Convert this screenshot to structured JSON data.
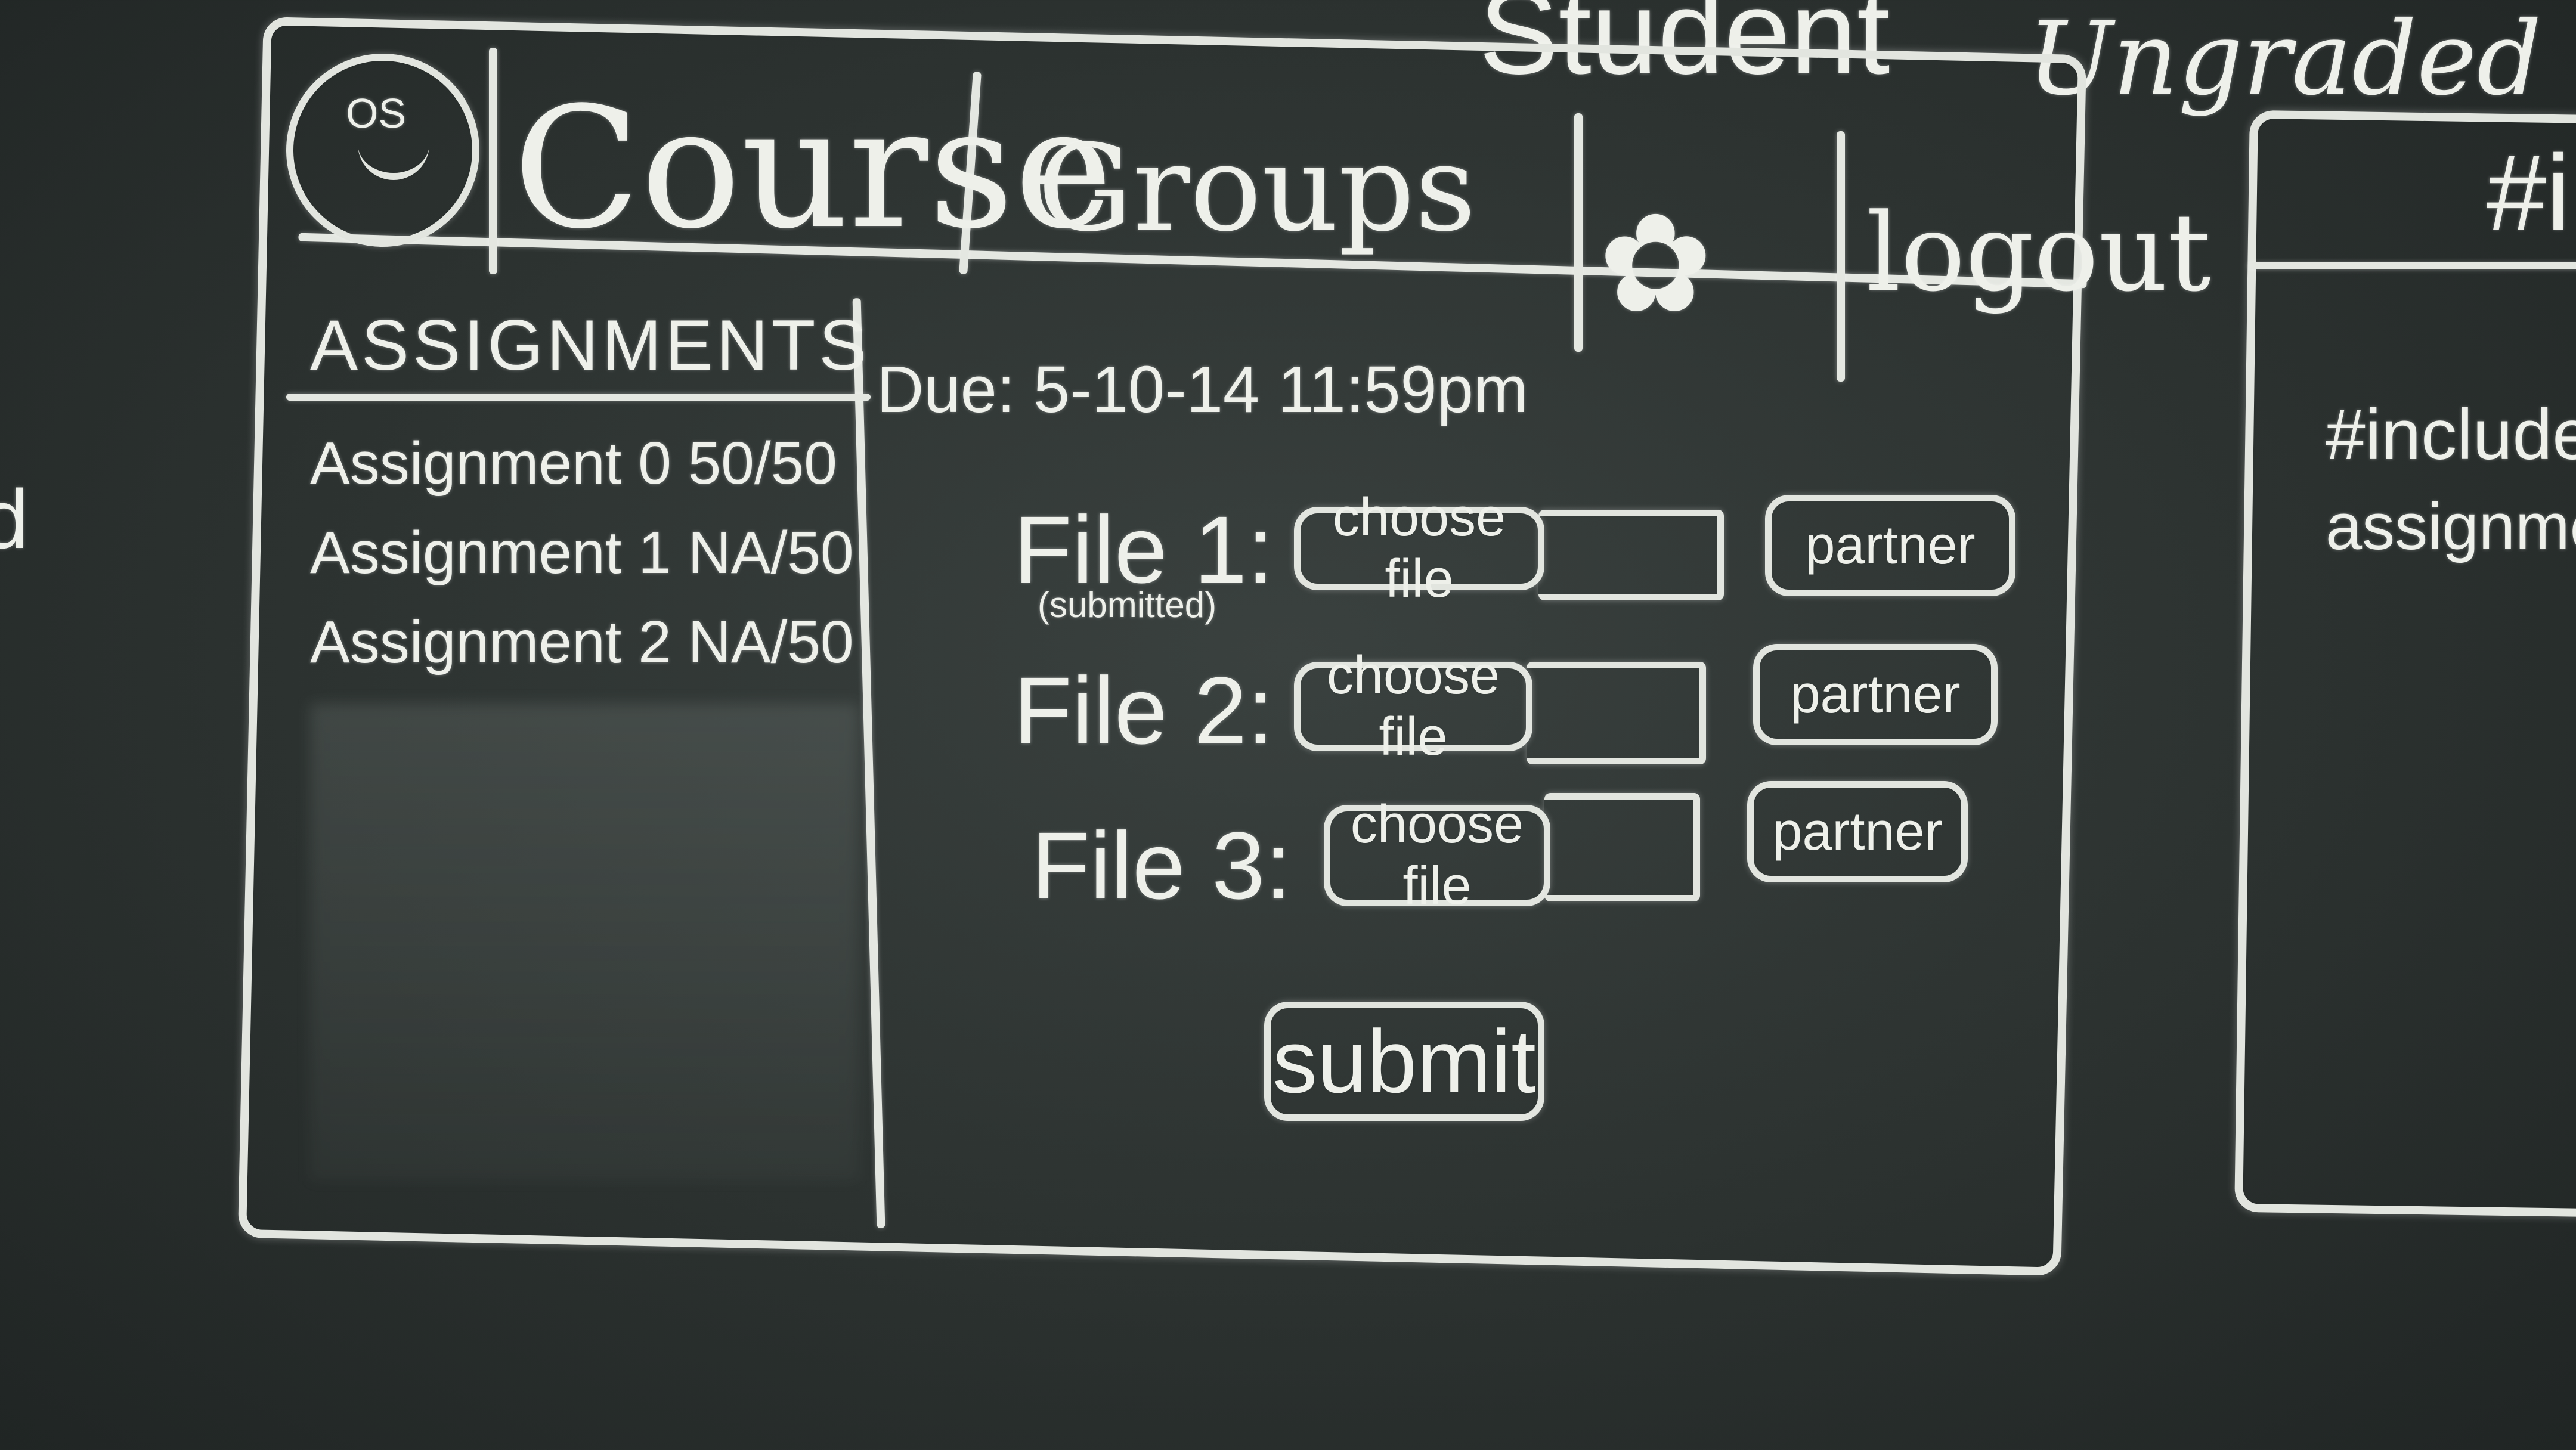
{
  "board": {
    "top_scrawl": "Student",
    "top_right_label": "Ungraded",
    "left_fragment": "d"
  },
  "header": {
    "logo_text": "OS",
    "nav_items": [
      "Course",
      "Groups"
    ],
    "settings_icon": "gear-icon",
    "logout_label": "logout"
  },
  "sidebar": {
    "title": "ASSIGNMENTS",
    "items": [
      {
        "label": "Assignment 0",
        "score": "50/50"
      },
      {
        "label": "Assignment 1",
        "score": "NA/50"
      },
      {
        "label": "Assignment 2",
        "score": "NA/50"
      }
    ]
  },
  "main": {
    "due": "Due: 5-10-14 11:59pm",
    "files": [
      {
        "label": "File 1:",
        "sublabel": "(submitted)",
        "choose": "choose file",
        "partner": "partner"
      },
      {
        "label": "File 2:",
        "sublabel": "",
        "choose": "choose file",
        "partner": "partner"
      },
      {
        "label": "File 3:",
        "sublabel": "",
        "choose": "choose file",
        "partner": "partner"
      }
    ],
    "submit_label": "submit"
  },
  "right_panel": {
    "tab_label": "#i",
    "code_line_1": "#include",
    "code_line_2": "assignmen"
  }
}
